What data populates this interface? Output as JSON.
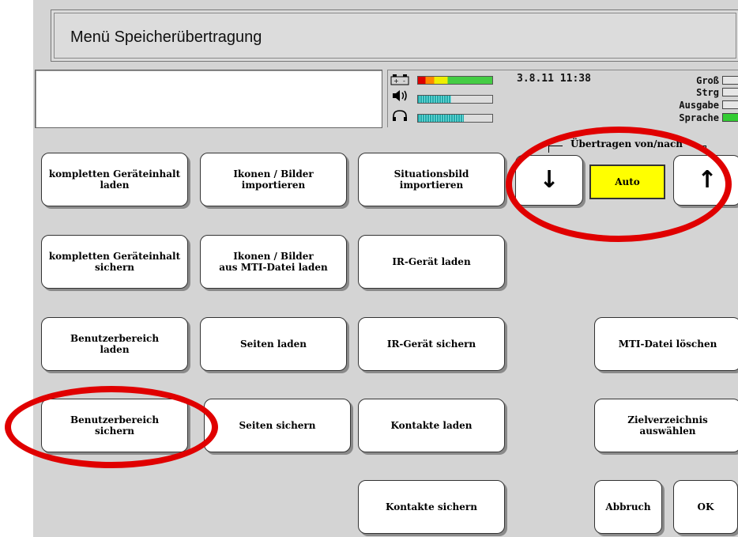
{
  "title": "Menü Speicherübertragung",
  "status": {
    "datetime": "3.8.11 11:38",
    "indicators": [
      "Groß",
      "Strg",
      "Ausgabe",
      "Sprache"
    ],
    "battery_icon": "battery-icon",
    "speaker_icon": "speaker-icon",
    "headphones_icon": "headphones-icon"
  },
  "transfer": {
    "label": "Übertragen von/nach",
    "down_arrow": "↓",
    "up_arrow": "↑",
    "mode": "Auto"
  },
  "buttons": {
    "load_all": "kompletten Geräteinhalt\nladen",
    "icons_import": "Ikonen / Bilder\nimportieren",
    "situation_import": "Situationsbild importieren",
    "save_all": "kompletten Geräteinhalt\nsichern",
    "icons_mti_load": "Ikonen / Bilder\naus MTI-Datei laden",
    "ir_load": "IR-Gerät laden",
    "user_load": "Benutzerbereich\nladen",
    "pages_load": "Seiten laden",
    "ir_save": "IR-Gerät sichern",
    "mti_delete": "MTI-Datei löschen",
    "user_save": "Benutzerbereich\nsichern",
    "pages_save": "Seiten sichern",
    "contacts_load": "Kontakte laden",
    "target_dir": "Zielverzeichnis auswählen",
    "contacts_save": "Kontakte sichern",
    "cancel": "Abbruch",
    "ok": "OK"
  },
  "colors": {
    "highlight": "#e00000",
    "auto_bg": "#ffff00",
    "panel_bg": "#d4d4d4"
  }
}
